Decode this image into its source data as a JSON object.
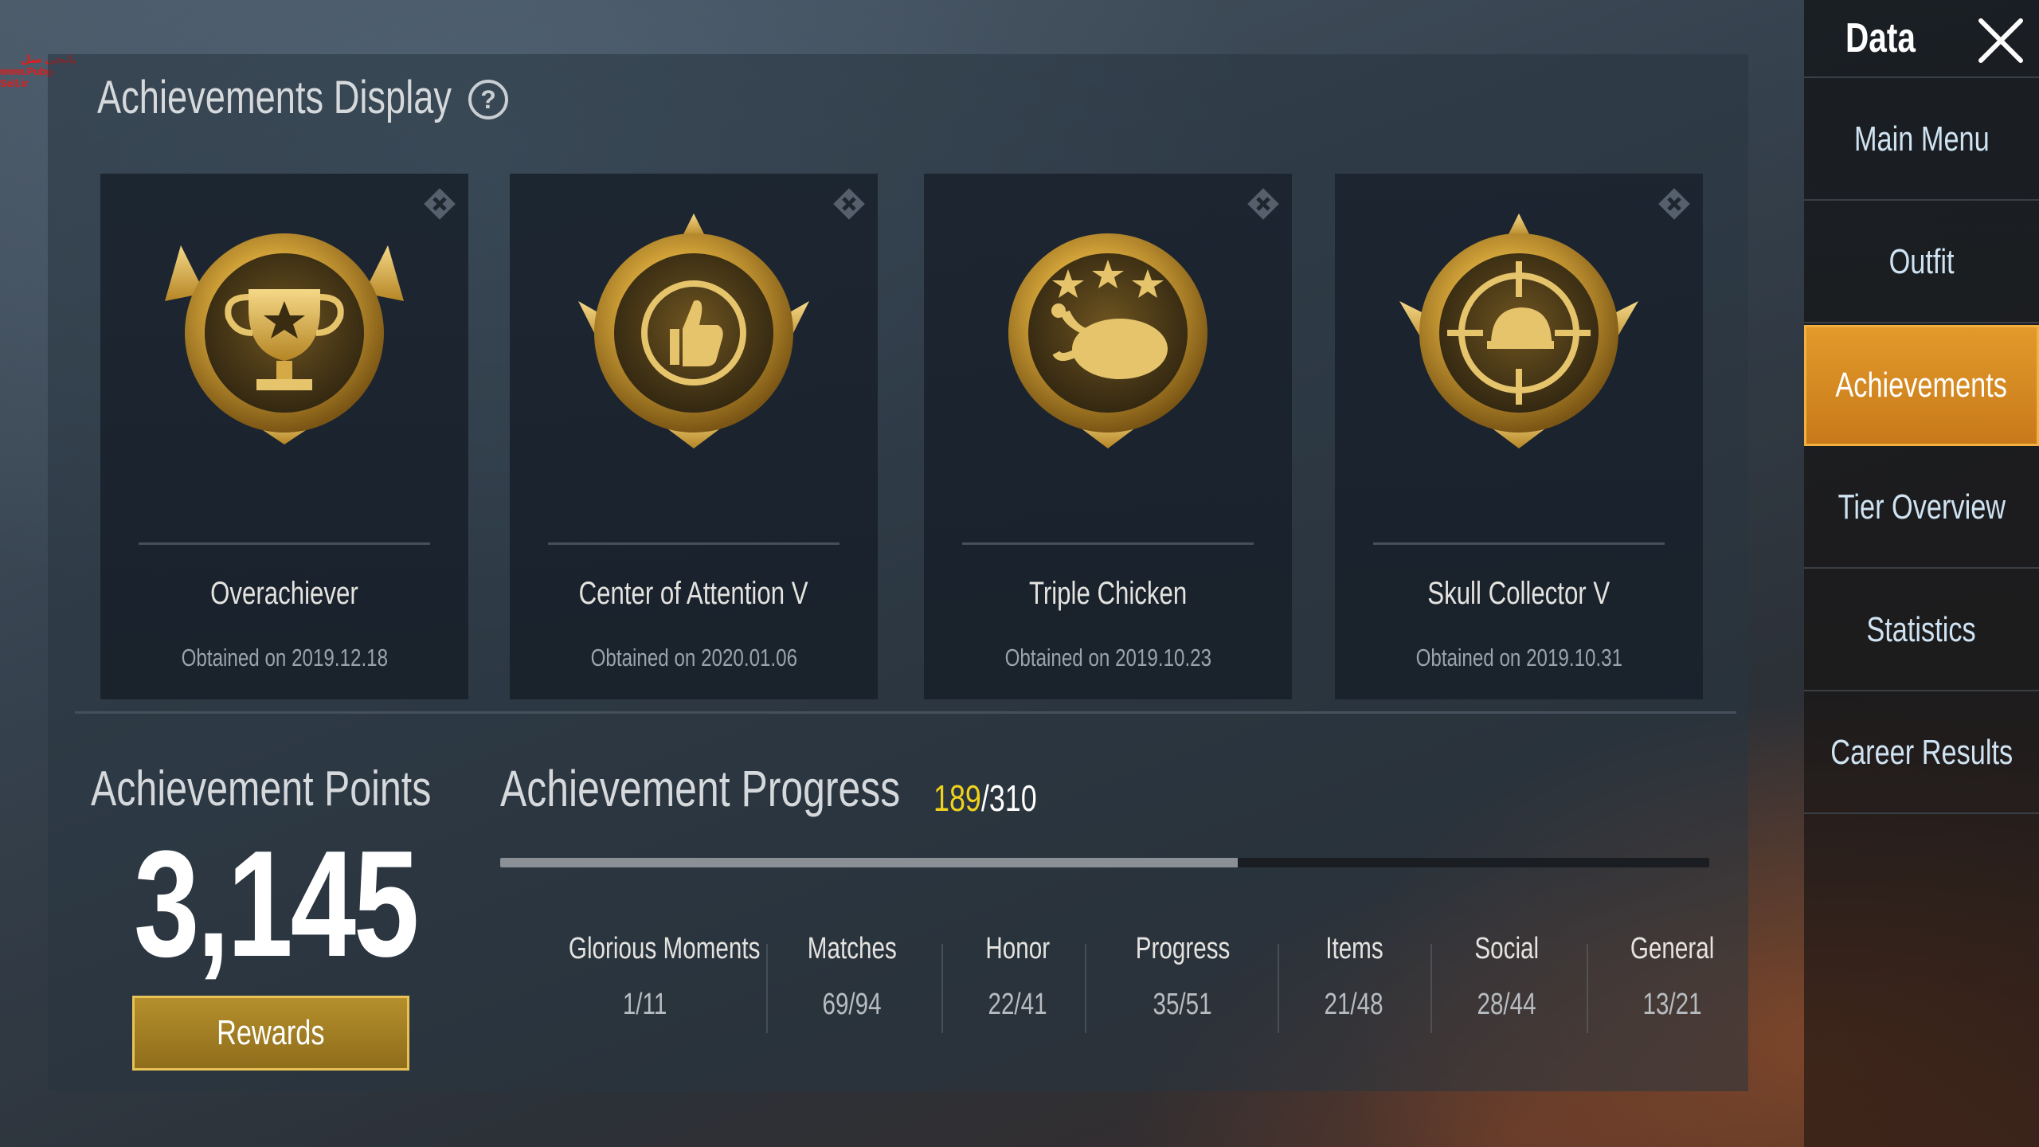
{
  "watermark": {
    "line1": "پابجی سل",
    "line2": "www.Pubg-Sell.ir"
  },
  "display": {
    "title": "Achievements Display",
    "help_icon": "question-circle-icon"
  },
  "cards": [
    {
      "name": "Overachiever",
      "date": "Obtained on 2019.12.18",
      "medal_icon": "trophy-icon"
    },
    {
      "name": "Center of Attention V",
      "date": "Obtained on 2020.01.06",
      "medal_icon": "thumbs-up-icon"
    },
    {
      "name": "Triple Chicken",
      "date": "Obtained on 2019.10.23",
      "medal_icon": "chicken-icon"
    },
    {
      "name": "Skull Collector V",
      "date": "Obtained on 2019.10.31",
      "medal_icon": "crosshair-icon"
    }
  ],
  "points": {
    "title": "Achievement Points",
    "value": "3,145",
    "rewards_label": "Rewards"
  },
  "progress": {
    "title": "Achievement Progress",
    "current": "189",
    "total": "/310",
    "fraction": 0.61
  },
  "categories": [
    {
      "label": "Glorious Moments",
      "value": "1/11"
    },
    {
      "label": "Matches",
      "value": "69/94"
    },
    {
      "label": "Honor",
      "value": "22/41"
    },
    {
      "label": "Progress",
      "value": "35/51"
    },
    {
      "label": "Items",
      "value": "21/48"
    },
    {
      "label": "Social",
      "value": "28/44"
    },
    {
      "label": "General",
      "value": "13/21"
    }
  ],
  "sidebar": {
    "title": "Data",
    "items": [
      {
        "label": "Main Menu"
      },
      {
        "label": "Outfit"
      },
      {
        "label": "Achievements",
        "active": true
      },
      {
        "label": "Tier Overview"
      },
      {
        "label": "Statistics"
      },
      {
        "label": "Career Results"
      }
    ]
  },
  "colors": {
    "accent_orange": "#e29a2a",
    "gold": "#c9a040",
    "progress_highlight": "#f0d21c"
  }
}
